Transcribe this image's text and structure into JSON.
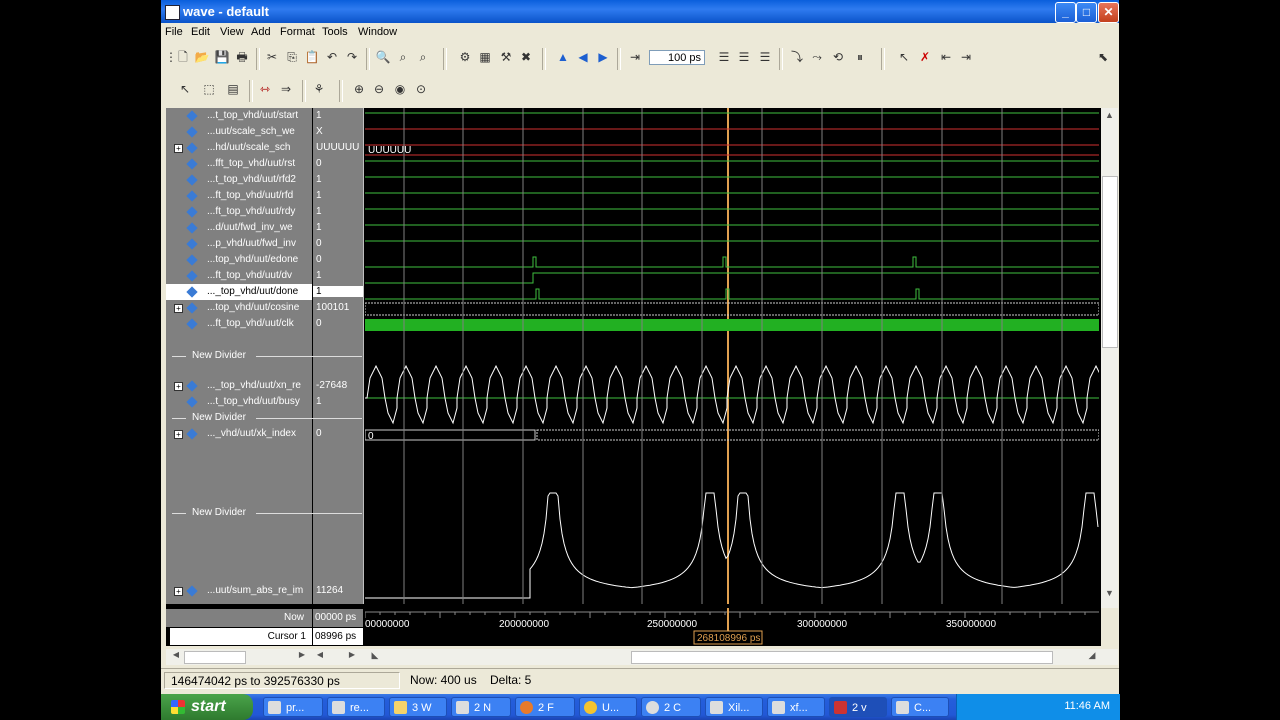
{
  "window": {
    "title": "wave - default",
    "controls": {
      "minimize": "_",
      "maximize": "□",
      "close": "✕"
    }
  },
  "menu": [
    "File",
    "Edit",
    "View",
    "Add",
    "Format",
    "Tools",
    "Window"
  ],
  "toolbar": {
    "zoom_value": "100 ps"
  },
  "signals": [
    {
      "name": "...t_top_vhd/uut/start",
      "value": "1",
      "expandable": false
    },
    {
      "name": "...uut/scale_sch_we",
      "value": "X",
      "expandable": false
    },
    {
      "name": "...hd/uut/scale_sch",
      "value": "UUUUUU",
      "expandable": true
    },
    {
      "name": "...fft_top_vhd/uut/rst",
      "value": "0",
      "expandable": false
    },
    {
      "name": "...t_top_vhd/uut/rfd2",
      "value": "1",
      "expandable": false
    },
    {
      "name": "...ft_top_vhd/uut/rfd",
      "value": "1",
      "expandable": false
    },
    {
      "name": "...ft_top_vhd/uut/rdy",
      "value": "1",
      "expandable": false
    },
    {
      "name": "...d/uut/fwd_inv_we",
      "value": "1",
      "expandable": false
    },
    {
      "name": "...p_vhd/uut/fwd_inv",
      "value": "0",
      "expandable": false
    },
    {
      "name": "...top_vhd/uut/edone",
      "value": "0",
      "expandable": false
    },
    {
      "name": "...ft_top_vhd/uut/dv",
      "value": "1",
      "expandable": false
    },
    {
      "name": "..._top_vhd/uut/done",
      "value": "1",
      "expandable": false,
      "selected": true
    },
    {
      "name": "...top_vhd/uut/cosine",
      "value": "100101",
      "expandable": true
    },
    {
      "name": "...ft_top_vhd/uut/clk",
      "value": "0",
      "expandable": false
    }
  ],
  "dividers": [
    "New Divider",
    "New Divider",
    "New Divider"
  ],
  "analog_signals": [
    {
      "name": "..._top_vhd/uut/xn_re",
      "value": "-27648",
      "expandable": true
    },
    {
      "name": "...t_top_vhd/uut/busy",
      "value": "1",
      "expandable": false
    },
    {
      "name": "..._vhd/uut/xk_index",
      "value": "0",
      "expandable": true
    },
    {
      "name": "...uut/sum_abs_re_im",
      "value": "11264",
      "expandable": true
    }
  ],
  "waveform_labels": {
    "scale_sch_bus": "UUUUUU",
    "xk_index_bus": "0"
  },
  "timebar": {
    "now_label": "Now",
    "now_value": "00000 ps",
    "cursor_label": "Cursor 1",
    "cursor_value": "08996 ps",
    "cursor_flag": "268108996 ps",
    "ticks": [
      "00000000",
      "200000000",
      "250000000",
      "300000000",
      "350000000"
    ]
  },
  "status": {
    "range": "146474042 ps to 392576330 ps",
    "now": "Now: 400 us",
    "delta": "Delta: 5"
  },
  "taskbar": {
    "start": "start",
    "tasks": [
      "pr...",
      "re...",
      "3 W",
      "2 N",
      "2 F",
      "U...",
      "2 C",
      "Xil...",
      "xf...",
      "2 v",
      "C..."
    ],
    "clock": "11:46 AM"
  },
  "colors": {
    "cursor": "#e0a050",
    "wave_green": "#3fbf3f",
    "wave_red": "#d03030",
    "analog": "#ffffff",
    "divider": "#808080"
  }
}
